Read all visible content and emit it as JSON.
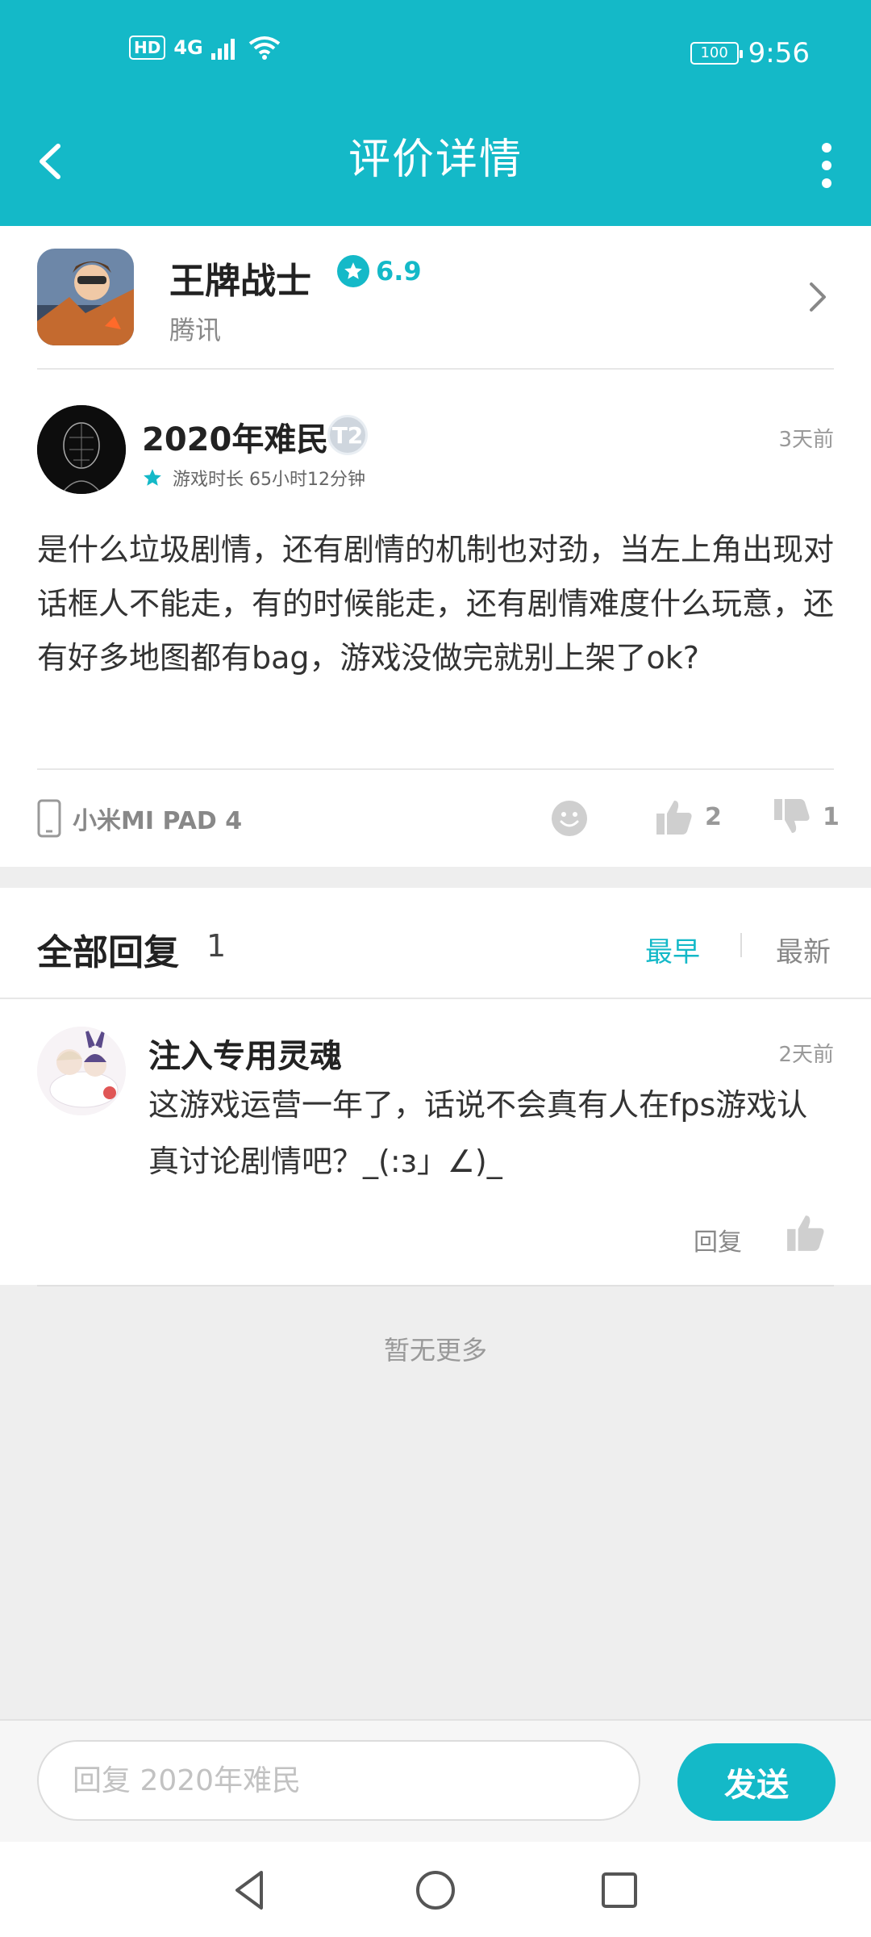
{
  "status_bar": {
    "hd_label": "HD",
    "network_label": "4G",
    "battery_label": "100",
    "time": "9:56"
  },
  "header": {
    "title": "评价详情"
  },
  "game": {
    "name": "王牌战士",
    "rating": "6.9",
    "publisher": "腾讯"
  },
  "review": {
    "author": "2020年难民",
    "level_badge": "T2",
    "time": "3天前",
    "playtime": "游戏时长 65小时12分钟",
    "text": "是什么垃圾剧情，还有剧情的机制也对劲，当左上角出现对话框人不能走，有的时候能走，还有剧情难度什么玩意，还有好多地图都有bag，游戏没做完就别上架了ok?",
    "device": "小米MI PAD 4",
    "likes": "2",
    "dislikes": "1"
  },
  "replies_section": {
    "title": "全部回复",
    "count": "1",
    "sort_earliest": "最早",
    "sort_latest": "最新"
  },
  "replies": [
    {
      "author": "注入专用灵魂",
      "time": "2天前",
      "text": "这游戏运营一年了，话说不会真有人在fps游戏认真讨论剧情吧？_(:з」∠)_",
      "reply_label": "回复"
    }
  ],
  "footer_note": "暂无更多",
  "reply_bar": {
    "placeholder": "回复 2020年难民",
    "send_label": "发送"
  },
  "colors": {
    "accent": "#14b9c8",
    "background_gray": "#eeeeee"
  },
  "icons": {
    "back": "chevron-left-icon",
    "more": "more-vertical-icon",
    "rating": "star-icon",
    "device": "phone-icon",
    "emoji": "smiley-icon",
    "like": "thumbs-up-icon",
    "dislike": "thumbs-down-icon"
  }
}
